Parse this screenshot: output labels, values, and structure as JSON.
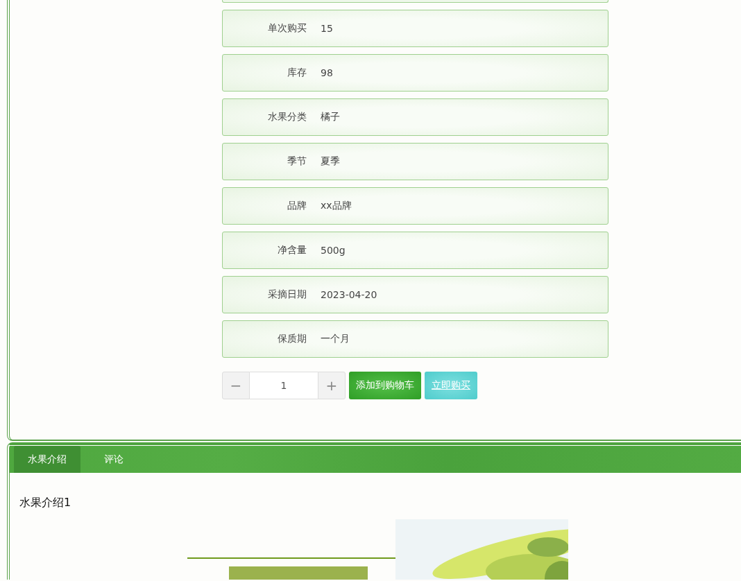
{
  "details": [
    {
      "label": "单次购买",
      "value": "15"
    },
    {
      "label": "库存",
      "value": "98"
    },
    {
      "label": "水果分类",
      "value": "橘子"
    },
    {
      "label": "季节",
      "value": "夏季"
    },
    {
      "label": "品牌",
      "value": "xx品牌"
    },
    {
      "label": "净含量",
      "value": "500g"
    },
    {
      "label": "采摘日期",
      "value": "2023-04-20"
    },
    {
      "label": "保质期",
      "value": "一个月"
    }
  ],
  "quantity": {
    "decrement": "−",
    "value": "1",
    "increment": "+"
  },
  "actions": [
    {
      "label": "添加到购物车",
      "kind": "cart"
    },
    {
      "label": "立即购买",
      "kind": "buy"
    }
  ],
  "tabs": [
    {
      "label": "水果介绍",
      "selected": true
    },
    {
      "label": "评论",
      "selected": false
    }
  ],
  "intro": {
    "text": "水果介绍1"
  }
}
